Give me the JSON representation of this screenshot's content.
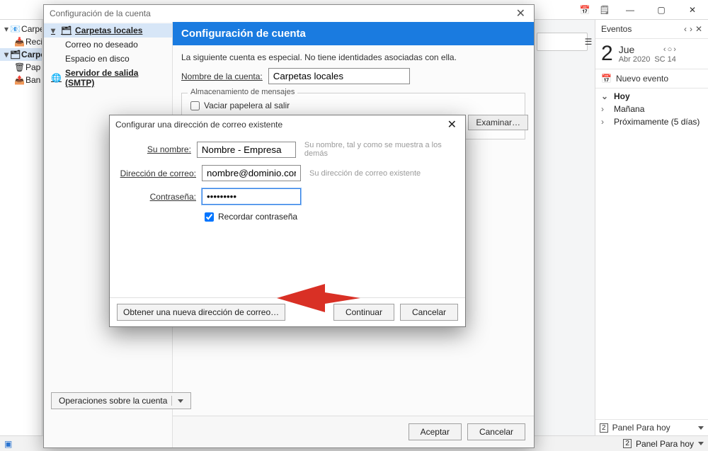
{
  "window": {
    "minimize": "—",
    "maximize": "▢",
    "close": "✕"
  },
  "topicons": {
    "cal": "📅",
    "note": "🗒"
  },
  "leftTree": {
    "items": [
      {
        "label": "Carpe",
        "strong": true
      },
      {
        "label": "Recib"
      },
      {
        "label": "Carpe",
        "strong": true
      },
      {
        "label": "Pap"
      },
      {
        "label": "Ban"
      }
    ]
  },
  "events": {
    "title": "Eventos",
    "nav": {
      "prev": "‹",
      "next": "›",
      "close": "✕"
    },
    "dayNum": "2",
    "dayName": "Jue",
    "month": "Abr 2020",
    "week": "SC 14",
    "datenav": {
      "prev": "‹",
      "today": "○",
      "next": "›"
    },
    "newEvent": "Nuevo evento",
    "sections": {
      "today": "Hoy",
      "tomorrow": "Mañana",
      "soon": "Próximamente (5 días)"
    },
    "footer": "Panel Para hoy"
  },
  "settingsDialog": {
    "title": "Configuración de la cuenta",
    "sidebar": {
      "localFolders": "Carpetas locales",
      "junk": "Correo no deseado",
      "disk": "Espacio en disco",
      "smtp": "Servidor de salida (SMTP)"
    },
    "banner": "Configuración de cuenta",
    "desc": "La siguiente cuenta es especial. No tiene identidades asociadas con ella.",
    "acctNameLabel": "Nombre de la cuenta:",
    "acctNameValue": "Carpetas locales",
    "storage": {
      "group": "Almacenamiento de mensajes",
      "emptyTrash": "Vaciar papelera al salir",
      "browse": "Examinar…"
    },
    "opsBtn": "Operaciones sobre la cuenta",
    "ok": "Aceptar",
    "cancel": "Cancelar"
  },
  "mailDialog": {
    "title": "Configurar una dirección de correo existente",
    "labels": {
      "name": "Su nombre:",
      "email": "Dirección de correo:",
      "password": "Contraseña:"
    },
    "values": {
      "name": "Nombre - Empresa",
      "email": "nombre@dominio.com",
      "password": "•••••••••"
    },
    "hints": {
      "name": "Su nombre, tal y como se muestra a los demás",
      "email": "Su dirección de correo existente"
    },
    "remember": "Recordar contraseña",
    "getNew": "Obtener una nueva dirección de correo…",
    "continue": "Continuar",
    "cancel": "Cancelar"
  },
  "statusbar": {
    "panel": "Panel Para hoy"
  }
}
